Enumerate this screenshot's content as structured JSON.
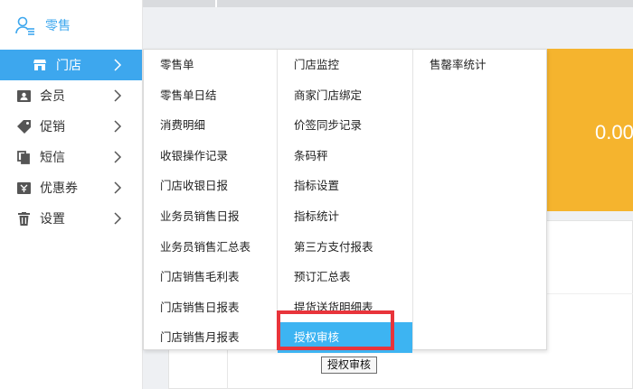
{
  "brand": {
    "label": "零售",
    "icon": "user-list-icon"
  },
  "sidebar": {
    "items": [
      {
        "label": "门店",
        "icon": "store-icon",
        "active": true
      },
      {
        "label": "会员",
        "icon": "member-card-icon"
      },
      {
        "label": "促销",
        "icon": "tag-icon"
      },
      {
        "label": "短信",
        "icon": "copy-icon"
      },
      {
        "label": "优惠券",
        "icon": "coupon-icon"
      },
      {
        "label": "设置",
        "icon": "trash-icon"
      }
    ]
  },
  "card": {
    "value": "0.00"
  },
  "menu": {
    "col1": [
      "零售单",
      "零售单日结",
      "消费明细",
      "收银操作记录",
      "门店收银日报",
      "业务员销售日报",
      "业务员销售汇总表",
      "门店销售毛利表",
      "门店销售日报表",
      "门店销售月报表"
    ],
    "col2": [
      "门店监控",
      "商家门店绑定",
      "价签同步记录",
      "条码秤",
      "指标设置",
      "指标统计",
      "第三方支付报表",
      "预订汇总表",
      "提货送货明细表",
      "授权审核"
    ],
    "col3": [
      "售罄率统计"
    ],
    "selected": "授权审核"
  },
  "tooltip": {
    "text": "授权审核"
  },
  "colors": {
    "accent": "#3da7ee",
    "highlight": "#e8343b",
    "card": "#f5b42e"
  }
}
